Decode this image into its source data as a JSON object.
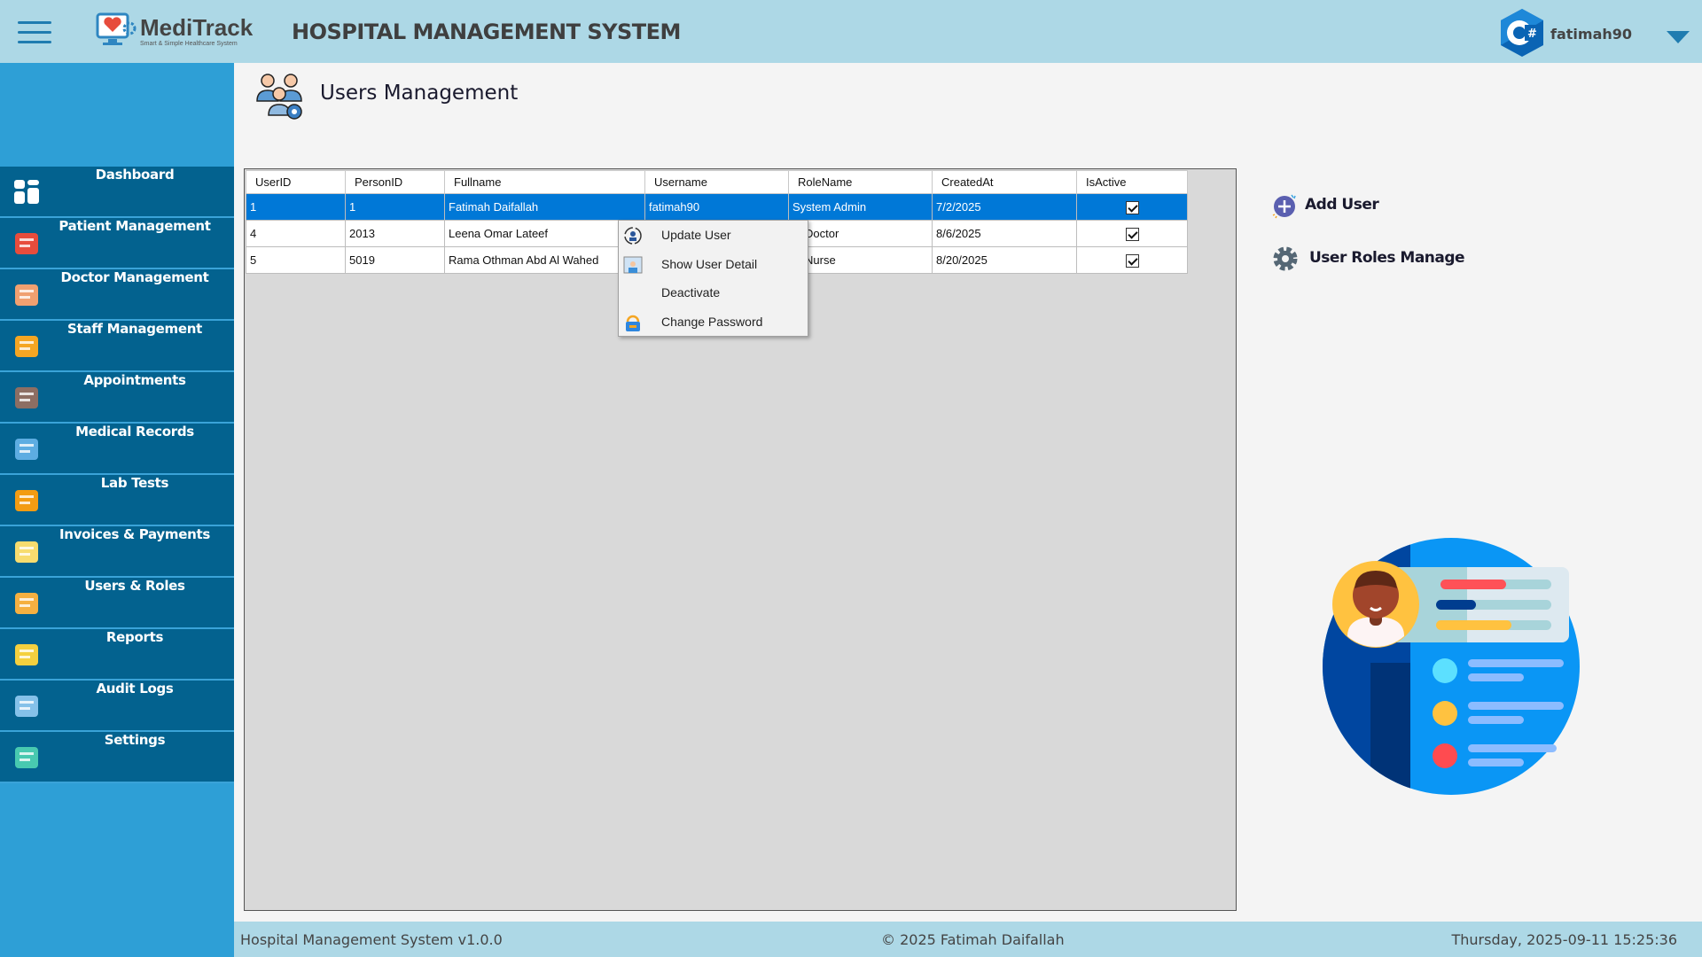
{
  "header": {
    "logo_name": "MediTrack",
    "logo_tagline": "Smart & Simple Healthcare System",
    "title": "HOSPITAL MANAGEMENT SYSTEM",
    "username": "fatimah90",
    "user_logo": "csharp-logo"
  },
  "sidebar": {
    "items": [
      {
        "label": "Dashboard",
        "icon": "dashboard-icon"
      },
      {
        "label": "Patient Management",
        "icon": "hospital-icon"
      },
      {
        "label": "Doctor Management",
        "icon": "doctors-icon"
      },
      {
        "label": "Staff Management",
        "icon": "staff-icon"
      },
      {
        "label": "Appointments",
        "icon": "calendar-icon"
      },
      {
        "label": "Medical Records",
        "icon": "records-icon"
      },
      {
        "label": "Lab Tests",
        "icon": "lab-icon"
      },
      {
        "label": "Invoices & Payments",
        "icon": "invoice-icon"
      },
      {
        "label": "Users & Roles",
        "icon": "users-roles-icon"
      },
      {
        "label": "Reports",
        "icon": "reports-icon"
      },
      {
        "label": "Audit Logs",
        "icon": "audit-icon"
      },
      {
        "label": "Settings",
        "icon": "settings-icon"
      }
    ]
  },
  "main": {
    "title": "Users Management",
    "table": {
      "columns": [
        "UserID",
        "PersonID",
        "Fullname",
        "Username",
        "RoleName",
        "CreatedAt",
        "IsActive"
      ],
      "rows": [
        {
          "cells": [
            "1",
            "1",
            "Fatimah Daifallah",
            "fatimah90",
            "System Admin",
            "7/2/2025"
          ],
          "active": true,
          "selected": true
        },
        {
          "cells": [
            "4",
            "2013",
            "Leena Omar Lateef",
            "",
            "Doctor",
            "8/6/2025"
          ],
          "active": true,
          "selected": false
        },
        {
          "cells": [
            "5",
            "5019",
            "Rama Othman Abd Al Wahed",
            "",
            "Nurse",
            "8/20/2025"
          ],
          "active": true,
          "selected": false
        }
      ]
    },
    "context_menu": [
      "Update User",
      "Show User Detail",
      "Deactivate",
      "Change Password"
    ],
    "actions": {
      "add_user": "Add User",
      "roles": "User Roles Manage"
    }
  },
  "footer": {
    "version": "Hospital Management System v1.0.0",
    "copyright": "© 2025 Fatimah Daifallah",
    "datetime": "Thursday, 2025-09-11 15:25:36"
  },
  "colors": {
    "header": "#add8e6",
    "sidebar": "#2e9fd6",
    "nav_item": "#03628f",
    "selection": "#0078d7"
  }
}
